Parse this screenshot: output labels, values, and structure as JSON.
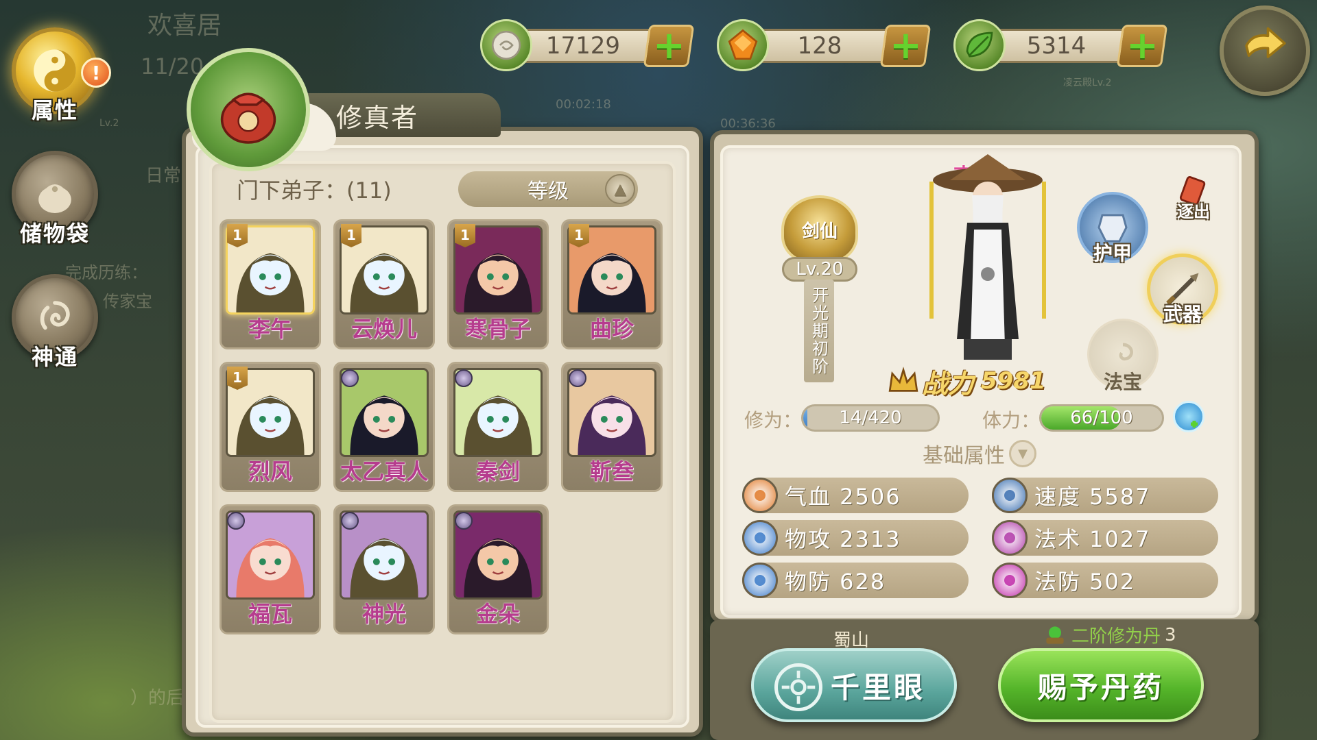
{
  "background": {
    "top_label": "欢喜居",
    "date_fragment": "11/20",
    "timer_1": "00:02:18",
    "timer_2": "00:36:36",
    "quest_text": "完成历练：",
    "quest_item": "传家宝",
    "side_label": "日常",
    "map_label": "凌云殿Lv.2",
    "lv_label": "Lv.2",
    "bottom_text": "）的后"
  },
  "nav": {
    "attributes": {
      "label": "属性",
      "icon": "yin-yang-icon",
      "alert": "!"
    },
    "storage": {
      "label": "储物袋",
      "icon": "bag-icon"
    },
    "abilities": {
      "label": "神通",
      "icon": "swirl-icon"
    }
  },
  "currencies": [
    {
      "name": "silver",
      "icon": "silver-coin-icon",
      "value": "17129"
    },
    {
      "name": "gem",
      "icon": "orange-gem-icon",
      "value": "128"
    },
    {
      "name": "leaf",
      "icon": "green-leaf-icon",
      "value": "5314"
    }
  ],
  "left_panel": {
    "title": "修真者",
    "disciples_label": "门下弟子：(11)",
    "sort_label": "等级",
    "disciples": [
      {
        "name": "李午",
        "level_tag": "1",
        "selected": true
      },
      {
        "name": "云焕儿",
        "level_tag": "1"
      },
      {
        "name": "寒骨子",
        "level_tag": "1"
      },
      {
        "name": "曲珍",
        "level_tag": "1"
      },
      {
        "name": "烈风",
        "level_tag": "1"
      },
      {
        "name": "太乙真人",
        "level_tag": ""
      },
      {
        "name": "秦剑",
        "level_tag": ""
      },
      {
        "name": "靳叁",
        "level_tag": ""
      },
      {
        "name": "福瓦",
        "level_tag": ""
      },
      {
        "name": "神光",
        "level_tag": ""
      },
      {
        "name": "金朵",
        "level_tag": ""
      }
    ]
  },
  "right_panel": {
    "character_name": "李午",
    "class_name": "剑仙",
    "class_level": "Lv.20",
    "realm": "开光期初阶",
    "power_label": "战力",
    "power_value": "5981",
    "equipment": {
      "expel": "逐出",
      "armor": "护甲",
      "weapon": "武器",
      "treasure": "法宝"
    },
    "cultivation_label": "修为：",
    "cultivation_value": "14/420",
    "cultivation_fraction": 0.033,
    "stamina_label": "体力：",
    "stamina_value": "66/100",
    "stamina_fraction": 0.66,
    "basic_attributes_label": "基础属性",
    "stats": [
      {
        "key": "hp",
        "text": "气血 2506",
        "color": "#e07a2a",
        "icon": "heart-icon"
      },
      {
        "key": "speed",
        "text": "速度 5587",
        "color": "#3b6fb0",
        "icon": "wind-icon"
      },
      {
        "key": "phys_atk",
        "text": "物攻 2313",
        "color": "#3b7ac8",
        "icon": "sword-icon"
      },
      {
        "key": "magic",
        "text": "法术 1027",
        "color": "#b03aa8",
        "icon": "flame-icon"
      },
      {
        "key": "phys_def",
        "text": "物防 628",
        "color": "#3b7ac8",
        "icon": "shield-icon"
      },
      {
        "key": "magic_def",
        "text": "法防 502",
        "color": "#c02aa8",
        "icon": "orb-icon"
      }
    ],
    "sect": "蜀山",
    "pill_name": "二阶修为丹",
    "pill_count": "3",
    "search_button": "千里眼",
    "grant_button": "赐予丹药"
  },
  "colors": {
    "name_pink": "#b63c8e",
    "power_gold": "#f6d66a",
    "stamina_green": "#5cc23a",
    "cultivation_blue": "#4a8bd0"
  }
}
